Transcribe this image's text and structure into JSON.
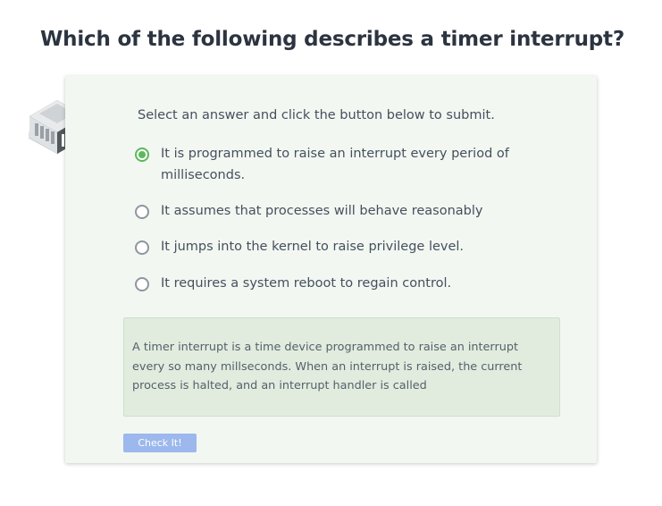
{
  "question": {
    "title": "Which of the following describes a timer interrupt?"
  },
  "quiz": {
    "icon": "server-rack-icon",
    "instructions": "Select an answer and click the button below to submit.",
    "options": [
      {
        "label": "It is programmed to raise an interrupt every period of milliseconds.",
        "selected": true
      },
      {
        "label": "It assumes that processes will behave reasonably",
        "selected": false
      },
      {
        "label": "It jumps into the kernel to raise privilege level.",
        "selected": false
      },
      {
        "label": "It requires a system reboot to regain control.",
        "selected": false
      }
    ],
    "explanation": "A timer interrupt is a time device programmed to raise an interrupt every so many millseconds. When an interrupt is raised, the current process is halted, and an interrupt handler is called",
    "submit_label": "Check It!"
  },
  "colors": {
    "selected_radio": "#5cb85c",
    "button_disabled": "#9cb8ec",
    "explanation_bg": "#e1ecdf",
    "card_bg": "#f2f7f2"
  }
}
